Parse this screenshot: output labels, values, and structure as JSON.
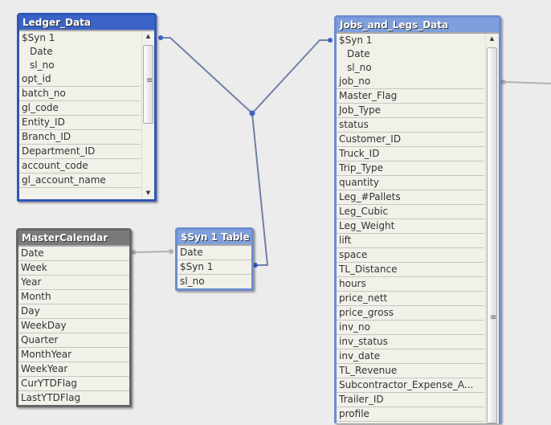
{
  "colors": {
    "selected_header": "#3a62c8",
    "linked_header": "#7f9fdc",
    "plain_header": "#7a7a7a",
    "link_line": "#7080a8",
    "inactive_line": "#b0b0b0"
  },
  "tables": {
    "ledger": {
      "title": "Ledger_Data",
      "key_group": [
        "$Syn 1",
        "Date",
        "sl_no"
      ],
      "fields": [
        "opt_id",
        "batch_no",
        "gl_code",
        "Entity_ID",
        "Branch_ID",
        "Department_ID",
        "account_code",
        "gl_account_name"
      ]
    },
    "jobs": {
      "title": "Jobs_and_Legs_Data",
      "key_group": [
        "$Syn 1",
        "Date",
        "sl_no"
      ],
      "fields": [
        "job_no",
        "Master_Flag",
        "Job_Type",
        "status",
        "Customer_ID",
        "Truck_ID",
        "Trip_Type",
        "quantity",
        "Leg_#Pallets",
        "Leg_Cubic",
        "Leg_Weight",
        "lift",
        "space",
        "TL_Distance",
        "hours",
        "price_nett",
        "price_gross",
        "inv_no",
        "inv_status",
        "inv_date",
        "TL_Revenue",
        "Subcontractor_Expense_A...",
        "Trailer_ID",
        "profile"
      ]
    },
    "calendar": {
      "title": "MasterCalendar",
      "fields": [
        "Date",
        "Week",
        "Year",
        "Month",
        "Day",
        "WeekDay",
        "Quarter",
        "MonthYear",
        "WeekYear",
        "CurYTDFlag",
        "LastYTDFlag"
      ]
    },
    "syn": {
      "title": "$Syn 1 Table",
      "fields": [
        "Date",
        "$Syn 1",
        "sl_no"
      ]
    }
  }
}
